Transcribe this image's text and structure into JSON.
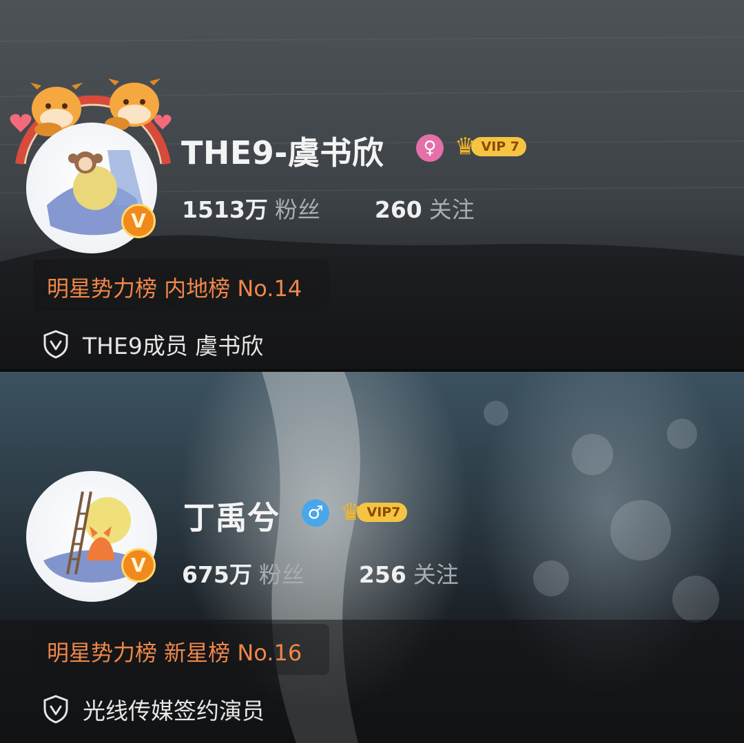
{
  "profiles": [
    {
      "name": "THE9-虞书欣",
      "gender_symbol": "♀",
      "gender_color": "#e56fa8",
      "vip_label": "VIP 7",
      "followers_count": "1513万",
      "followers_label": "粉丝",
      "following_count": "260",
      "following_label": "关注",
      "rank_text": "明星势力榜 内地榜 No.14",
      "verified_text": "THE9成员 虞书欣",
      "verified_badge": "V"
    },
    {
      "name": "丁禹兮",
      "gender_symbol": "♂",
      "gender_color": "#4aa6e8",
      "vip_label": "VIP7",
      "followers_count": "675万",
      "followers_label": "粉丝",
      "following_count": "256",
      "following_label": "关注",
      "rank_text": "明星势力榜 新星榜 No.16",
      "verified_text": "光线传媒签约演员",
      "verified_badge": "V"
    }
  ],
  "icons": {
    "gender_female": "female-icon",
    "gender_male": "male-icon",
    "vip_crown": "crown-icon",
    "verified_shield": "shield-check-icon",
    "verified_badge": "v-badge-icon"
  },
  "colors": {
    "rank_orange": "#f0874a",
    "vip_gold": "#f6c443",
    "badge_orange": "#f08a1c"
  }
}
